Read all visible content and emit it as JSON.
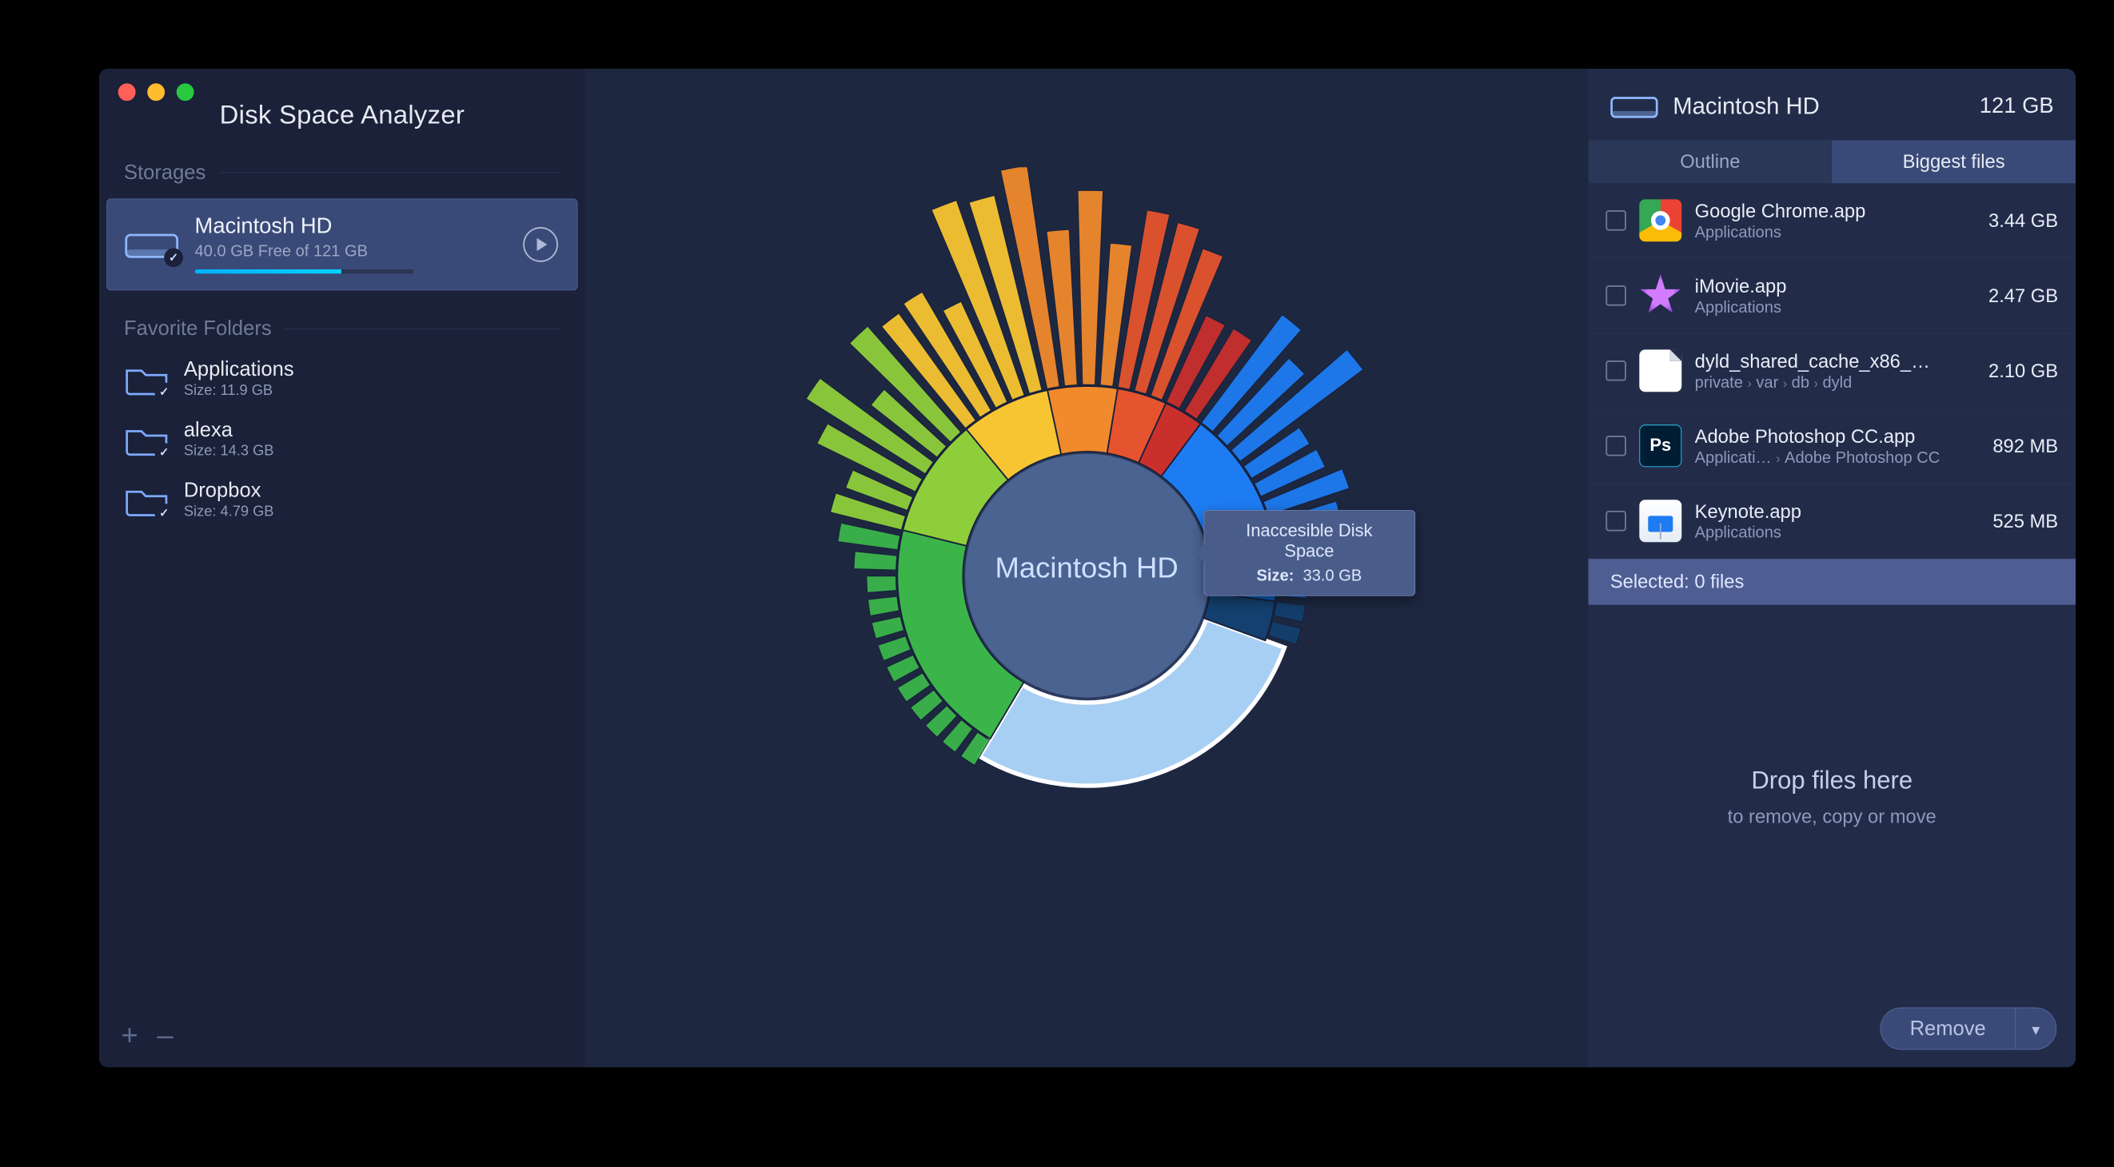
{
  "app": {
    "title": "Disk Space Analyzer"
  },
  "sidebar": {
    "storages_label": "Storages",
    "favorites_label": "Favorite Folders",
    "storage": {
      "name": "Macintosh HD",
      "subtitle": "40.0 GB Free of 121 GB",
      "progress_pct": 67
    },
    "favorites": [
      {
        "name": "Applications",
        "size_label": "Size: 11.9 GB",
        "glyph": "A"
      },
      {
        "name": "alexa",
        "size_label": "Size: 14.3 GB",
        "glyph": "⌂"
      },
      {
        "name": "Dropbox",
        "size_label": "Size: 4.79 GB",
        "glyph": ""
      }
    ],
    "add_label": "+",
    "remove_label": "–"
  },
  "chart": {
    "center_label": "Macintosh HD",
    "tooltip": {
      "title": "Inaccesible Disk Space",
      "size_prefix": "Size:",
      "size_value": "33.0 GB"
    }
  },
  "chart_data": {
    "type": "pie",
    "title": "Macintosh HD disk usage (sunburst)",
    "total_gb": 121,
    "free_gb": 40.0,
    "highlighted_segment": {
      "label": "Inaccesible Disk Space",
      "size_gb": 33.0
    },
    "inner_ring_segments": [
      {
        "color": "#a7cff3",
        "approx_gb": 33.0,
        "label": "Inaccesible Disk Space"
      },
      {
        "color": "#3bb54a",
        "approx_gb": 24
      },
      {
        "color": "#8fce3b",
        "approx_gb": 12
      },
      {
        "color": "#f7c531",
        "approx_gb": 9
      },
      {
        "color": "#f08a2c",
        "approx_gb": 7
      },
      {
        "color": "#e5542e",
        "approx_gb": 5
      },
      {
        "color": "#c9302c",
        "approx_gb": 4
      },
      {
        "color": "#1e7cf2",
        "approx_gb": 14
      },
      {
        "color": "#0b5bb5",
        "approx_gb": 6
      },
      {
        "color": "#13406f",
        "approx_gb": 4
      }
    ]
  },
  "right": {
    "disk_name": "Macintosh HD",
    "disk_size": "121 GB",
    "tabs": {
      "outline": "Outline",
      "biggest": "Biggest files"
    },
    "files": [
      {
        "name": "Google Chrome.app",
        "path": "Applications",
        "size": "3.44 GB",
        "icon": "chrome"
      },
      {
        "name": "iMovie.app",
        "path": "Applications",
        "size": "2.47 GB",
        "icon": "imovie"
      },
      {
        "name": "dyld_shared_cache_x86_…",
        "path_crumbs": [
          "private",
          "var",
          "db",
          "dyld"
        ],
        "size": "2.10 GB",
        "icon": "file"
      },
      {
        "name": "Adobe Photoshop CC.app",
        "path_crumbs": [
          "Applicati…",
          "Adobe Photoshop CC"
        ],
        "size": "892 MB",
        "icon": "ps",
        "ps_label": "Ps"
      },
      {
        "name": "Keynote.app",
        "path": "Applications",
        "size": "525 MB",
        "icon": "keynote"
      }
    ],
    "selected_label": "Selected: 0 files",
    "drop_title": "Drop files here",
    "drop_sub": "to remove, copy or move",
    "remove_label": "Remove"
  }
}
